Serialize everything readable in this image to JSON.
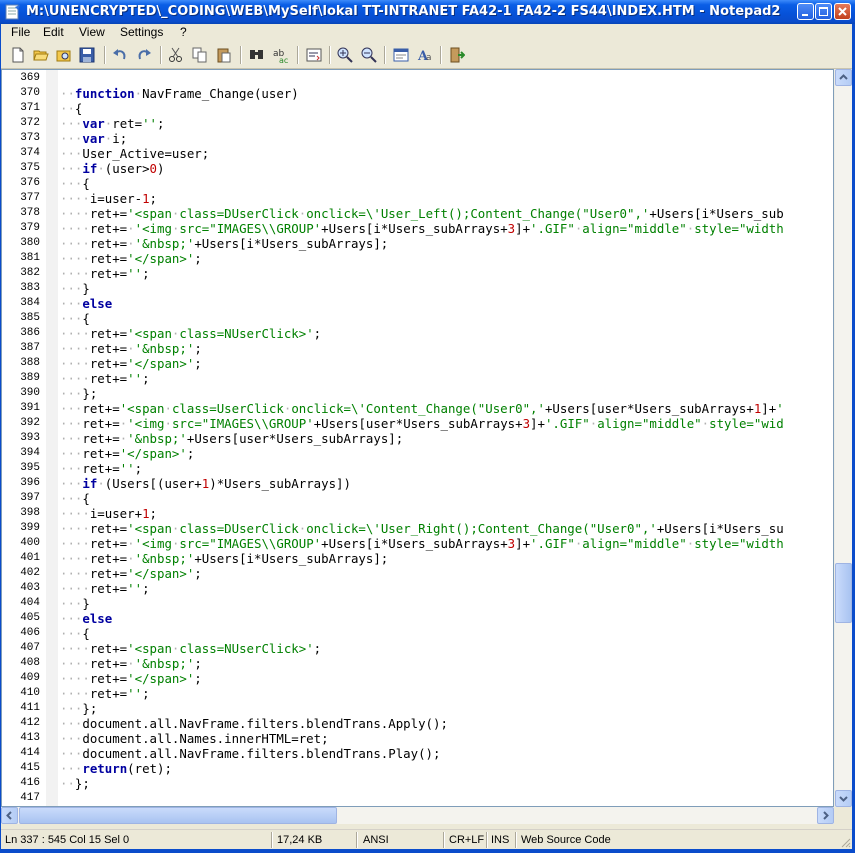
{
  "window": {
    "title": "M:\\UNENCRYPTED\\_CODING\\WEB\\MySelf\\lokal TT-INTRANET FA42-1 FA42-2 FS44\\INDEX.HTM - Notepad2",
    "minimize_icon": "minimize-icon",
    "maximize_icon": "maximize-icon",
    "close_icon": "close-icon"
  },
  "menu": {
    "file": "File",
    "edit": "Edit",
    "view": "View",
    "settings": "Settings",
    "help": "?"
  },
  "toolbar": [
    "new-icon",
    "open-icon",
    "browse-icon",
    "save-icon",
    "undo-icon",
    "redo-icon",
    "cut-icon",
    "copy-icon",
    "paste-icon",
    "find-icon",
    "replace-icon",
    "wordwrap-icon",
    "zoom-in-icon",
    "zoom-out-icon",
    "scheme-icon",
    "font-icon",
    "exit-icon"
  ],
  "editor": {
    "lines": [
      {
        "n": "369",
        "t": ""
      },
      {
        "n": "370",
        "t": "function NavFrame_Change(user)"
      },
      {
        "n": "371",
        "t": "{"
      },
      {
        "n": "372",
        "t": " var ret='';"
      },
      {
        "n": "373",
        "t": " var i;"
      },
      {
        "n": "374",
        "t": " User_Active=user;"
      },
      {
        "n": "375",
        "t": " if (user>0)"
      },
      {
        "n": "376",
        "t": " {"
      },
      {
        "n": "377",
        "t": "  i=user-1;"
      },
      {
        "n": "378",
        "t": "  ret+='<span class=DUserClick onclick=\\'User_Left();Content_Change(\"User0\",'+Users[i*Users_sub"
      },
      {
        "n": "379",
        "t": "  ret+= '<img src=\"IMAGES\\\\GROUP'+Users[i*Users_subArrays+3]+'.GIF\" align=\"middle\" style=\"width"
      },
      {
        "n": "380",
        "t": "  ret+= '&nbsp;'+Users[i*Users_subArrays];"
      },
      {
        "n": "381",
        "t": "  ret+='</span>';"
      },
      {
        "n": "382",
        "t": "  ret+='';"
      },
      {
        "n": "383",
        "t": " }"
      },
      {
        "n": "384",
        "t": " else"
      },
      {
        "n": "385",
        "t": " {"
      },
      {
        "n": "386",
        "t": "  ret+='<span class=NUserClick>';"
      },
      {
        "n": "387",
        "t": "  ret+= '&nbsp;';"
      },
      {
        "n": "388",
        "t": "  ret+='</span>';"
      },
      {
        "n": "389",
        "t": "  ret+='';"
      },
      {
        "n": "390",
        "t": " };"
      },
      {
        "n": "391",
        "t": " ret+='<span class=UserClick onclick=\\'Content_Change(\"User0\",'+Users[user*Users_subArrays+1]+'"
      },
      {
        "n": "392",
        "t": " ret+= '<img src=\"IMAGES\\\\GROUP'+Users[user*Users_subArrays+3]+'.GIF\" align=\"middle\" style=\"wid"
      },
      {
        "n": "393",
        "t": " ret+= '&nbsp;'+Users[user*Users_subArrays];"
      },
      {
        "n": "394",
        "t": " ret+='</span>';"
      },
      {
        "n": "395",
        "t": " ret+='';"
      },
      {
        "n": "396",
        "t": " if (Users[(user+1)*Users_subArrays])"
      },
      {
        "n": "397",
        "t": " {"
      },
      {
        "n": "398",
        "t": "  i=user+1;"
      },
      {
        "n": "399",
        "t": "  ret+='<span class=DUserClick onclick=\\'User_Right();Content_Change(\"User0\",'+Users[i*Users_su"
      },
      {
        "n": "400",
        "t": "  ret+= '<img src=\"IMAGES\\\\GROUP'+Users[i*Users_subArrays+3]+'.GIF\" align=\"middle\" style=\"width"
      },
      {
        "n": "401",
        "t": "  ret+= '&nbsp;'+Users[i*Users_subArrays];"
      },
      {
        "n": "402",
        "t": "  ret+='</span>';"
      },
      {
        "n": "403",
        "t": "  ret+='';"
      },
      {
        "n": "404",
        "t": " }"
      },
      {
        "n": "405",
        "t": " else"
      },
      {
        "n": "406",
        "t": " {"
      },
      {
        "n": "407",
        "t": "  ret+='<span class=NUserClick>';"
      },
      {
        "n": "408",
        "t": "  ret+= '&nbsp;';"
      },
      {
        "n": "409",
        "t": "  ret+='</span>';"
      },
      {
        "n": "410",
        "t": "  ret+='';"
      },
      {
        "n": "411",
        "t": " };"
      },
      {
        "n": "412",
        "t": " document.all.NavFrame.filters.blendTrans.Apply();"
      },
      {
        "n": "413",
        "t": " document.all.Names.innerHTML=ret;"
      },
      {
        "n": "414",
        "t": " document.all.NavFrame.filters.blendTrans.Play();"
      },
      {
        "n": "415",
        "t": " return(ret);"
      },
      {
        "n": "416",
        "t": "};"
      },
      {
        "n": "417",
        "t": ""
      }
    ]
  },
  "status": {
    "position": "Ln 337 : 545   Col 15   Sel 0",
    "size": "17,24 KB",
    "encoding": "ANSI",
    "line_ending": "CR+LF",
    "mode": "INS",
    "scheme": "Web Source Code"
  },
  "colors": {
    "keyword": "#0000a0",
    "string": "#008000",
    "number": "#c00000",
    "whitespace_dot": "#b0b0b0",
    "titlebar": "#0a5ee6"
  }
}
